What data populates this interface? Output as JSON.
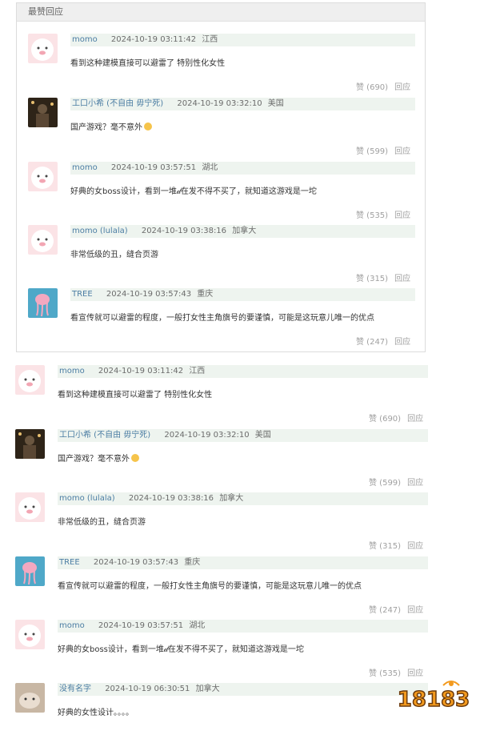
{
  "hot_section": {
    "title": "最赞回应",
    "comments": [
      {
        "user": "momo",
        "time": "2024-10-19 03:11:42",
        "location": "江西",
        "text": "看到这种建模直接可以避雷了 特别性化女性",
        "likes": "赞 (690)",
        "reply": "回应",
        "avatar": "pig"
      },
      {
        "user": "工口小希 (不自由 毋宁死)",
        "time": "2024-10-19 03:32:10",
        "location": "美国",
        "text": "国产游戏？毫不意外",
        "likes": "赞 (599)",
        "reply": "回应",
        "avatar": "dark"
      },
      {
        "user": "momo",
        "time": "2024-10-19 03:57:51",
        "location": "湖北",
        "text": "好典的女boss设计，看到一堆𝒹在发不得不买了，就知道这游戏是一坨",
        "likes": "赞 (535)",
        "reply": "回应",
        "avatar": "pig"
      },
      {
        "user": "momo (lulala)",
        "time": "2024-10-19 03:38:16",
        "location": "加拿大",
        "text": "非常低级的丑，缝合页游",
        "likes": "赞 (315)",
        "reply": "回应",
        "avatar": "pig"
      },
      {
        "user": "TREE",
        "time": "2024-10-19 03:57:43",
        "location": "重庆",
        "text": "看宣传就可以避雷的程度，一般打女性主角旗号的要谨慎，可能是这玩意儿唯一的优点",
        "likes": "赞 (247)",
        "reply": "回应",
        "avatar": "tree"
      }
    ]
  },
  "comments": [
    {
      "user": "momo",
      "time": "2024-10-19 03:11:42",
      "location": "江西",
      "text": "看到这种建模直接可以避雷了 特别性化女性",
      "likes": "赞 (690)",
      "reply": "回应",
      "avatar": "pig"
    },
    {
      "user": "工口小希 (不自由 毋宁死)",
      "time": "2024-10-19 03:32:10",
      "location": "美国",
      "text": "国产游戏？毫不意外",
      "likes": "赞 (599)",
      "reply": "回应",
      "avatar": "dark"
    },
    {
      "user": "momo (lulala)",
      "time": "2024-10-19 03:38:16",
      "location": "加拿大",
      "text": "非常低级的丑，缝合页游",
      "likes": "赞 (315)",
      "reply": "回应",
      "avatar": "pig"
    },
    {
      "user": "TREE",
      "time": "2024-10-19 03:57:43",
      "location": "重庆",
      "text": "看宣传就可以避雷的程度，一般打女性主角旗号的要谨慎，可能是这玩意儿唯一的优点",
      "likes": "赞 (247)",
      "reply": "回应",
      "avatar": "tree"
    },
    {
      "user": "momo",
      "time": "2024-10-19 03:57:51",
      "location": "湖北",
      "text": "好典的女boss设计，看到一堆𝒹在发不得不买了，就知道这游戏是一坨",
      "likes": "赞 (535)",
      "reply": "回应",
      "avatar": "pig"
    },
    {
      "user": "没有名字",
      "time": "2024-10-19 06:30:51",
      "location": "加拿大",
      "text": "好典的女性设计。。。。",
      "likes": "",
      "reply": "",
      "avatar": "cat"
    }
  ],
  "watermark": {
    "text": "18183"
  },
  "colors": {
    "meta_bg": "#eef4ef",
    "user": "#4b7da3",
    "watermark_orange": "#f39a1e"
  }
}
